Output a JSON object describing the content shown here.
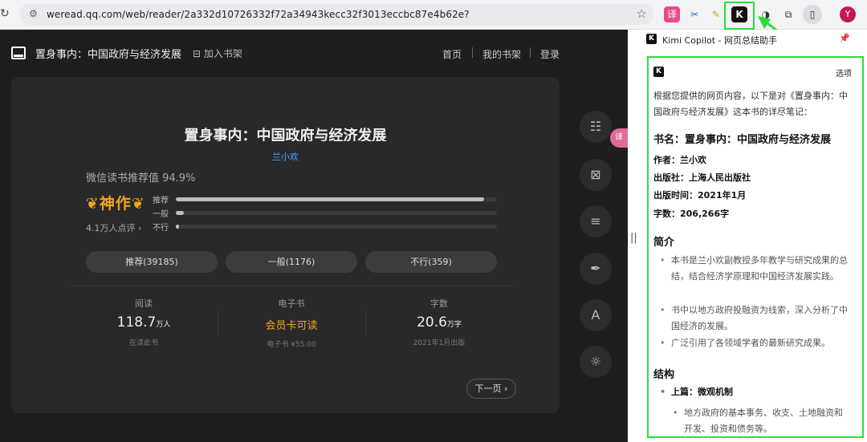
{
  "browser": {
    "url": "weread.qq.com/web/reader/2a332d10726332f72a34943kecc32f3013eccbc87e4b62e?",
    "avatar_letter": "Y",
    "highlight_color": "#2ddc3c"
  },
  "reader": {
    "title": "置身事内：中国政府与经济发展",
    "add_shelf": "加入书架",
    "nav": [
      "首页",
      "我的书架",
      "登录"
    ],
    "book_title": "置身事内：中国政府与经济发展",
    "author": "兰小欢",
    "rec_value": "微信读书推荐值 94.9%",
    "badge": "神作",
    "review_count": "4.1万人点评",
    "bars": [
      {
        "label": "推荐",
        "fraction": 0.96
      },
      {
        "label": "一般",
        "fraction": 0.025
      },
      {
        "label": "不行",
        "fraction": 0.005
      }
    ],
    "votes": [
      "推荐(39185)",
      "一般(1176)",
      "不行(359)"
    ],
    "stats": [
      {
        "key": "阅读",
        "value": "118.7",
        "unit": "万人",
        "sub": "在读此书"
      },
      {
        "key": "电子书",
        "value": "会员卡可读",
        "unit": "",
        "sub": "电子书 ¥55.00"
      },
      {
        "key": "字数",
        "value": "20.6",
        "unit": "万字",
        "sub": "2021年1月出版"
      }
    ],
    "next_page": "下一页",
    "side_icons": [
      "contents-icon",
      "hide-notes-icon",
      "menu-icon",
      "pen-icon",
      "font-icon",
      "brightness-icon"
    ],
    "font_label": "A"
  },
  "kimi": {
    "panel_title": "Kimi Copilot - 网页总结助手",
    "options": "选项",
    "intro": "根据您提供的网页内容，以下是对《置身事内：中国政府与经济发展》这本书的详尽笔记：",
    "book_heading": "书名：置身事内：中国政府与经济发展",
    "author_line": "作者：兰小欢",
    "publisher_line": "出版社：上海人民出版社",
    "date_line": "出版时间：2021年1月",
    "words_line": "字数：206,266字",
    "summary_heading": "简介",
    "summary_items": [
      "本书是兰小欢副教授多年教学与研究成果的总结，结合经济学原理和中国经济发展实践。",
      "书中以地方政府投融资为线索，深入分析了中国经济的发展。",
      "广泛引用了各领域学者的最新研究成果。"
    ],
    "structure_heading": "结构",
    "structure_part": "上篇：微观机制",
    "structure_sub": "地方政府的基本事务、收支、土地融资和开发、投资和债务等。"
  }
}
